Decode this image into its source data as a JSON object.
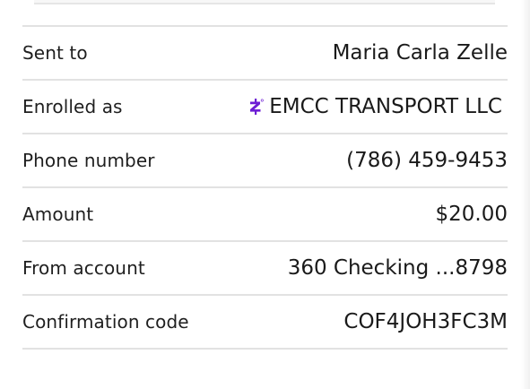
{
  "colors": {
    "zelle_purple": "#6d1ed4",
    "divider": "#e2e2e2"
  },
  "details": {
    "sent_to": {
      "label": "Sent to",
      "value": "Maria Carla Zelle"
    },
    "enrolled_as": {
      "label": "Enrolled as",
      "value": "EMCC TRANSPORT LLC",
      "icon": "zelle-logo-icon"
    },
    "phone_number": {
      "label": "Phone number",
      "value": "(786) 459-9453"
    },
    "amount": {
      "label": "Amount",
      "value": "$20.00"
    },
    "from_account": {
      "label": "From account",
      "value": "360 Checking ...8798"
    },
    "confirmation_code": {
      "label": "Confirmation code",
      "value": "COF4JOH3FC3M"
    }
  }
}
